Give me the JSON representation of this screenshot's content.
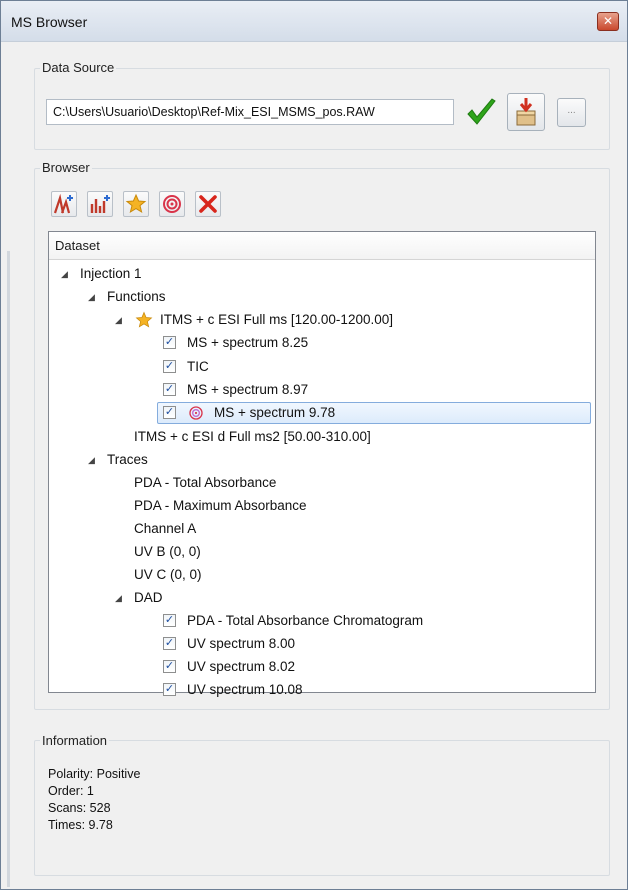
{
  "window": {
    "title": "MS Browser",
    "close_glyph": "✕"
  },
  "data_source": {
    "label": "Data Source",
    "path_value": "C:\\Users\\Usuario\\Desktop\\Ref-Mix_ESI_MSMS_pos.RAW",
    "browse_label": "..."
  },
  "browser": {
    "label": "Browser",
    "toolbar_icons": [
      "add-spectrum-icon",
      "add-chromatogram-icon",
      "star-icon",
      "target-icon",
      "delete-icon"
    ],
    "header": "Dataset",
    "tree": {
      "injection": "Injection 1",
      "functions": "Functions",
      "func1": "ITMS + c ESI Full ms [120.00-1200.00]",
      "func1_children": [
        "MS + spectrum 8.25",
        "TIC",
        "MS + spectrum 8.97",
        "MS + spectrum 9.78"
      ],
      "func2": "ITMS + c ESI d Full ms2  [50.00-310.00]",
      "traces": "Traces",
      "trace_items": [
        "PDA - Total Absorbance",
        "PDA - Maximum Absorbance",
        "Channel A",
        "UV B (0, 0)",
        "UV C (0, 0)"
      ],
      "dad": "DAD",
      "dad_children": [
        "PDA - Total Absorbance Chromatogram",
        "UV spectrum 8.00",
        "UV spectrum 8.02",
        "UV spectrum 10.08"
      ]
    }
  },
  "information": {
    "label": "Information",
    "polarity": "Polarity: Positive",
    "order": "Order: 1",
    "scans": "Scans:  528",
    "times": "Times:  9.78"
  },
  "colors": {
    "accent_check": "#2ea41a",
    "selection": "#dcebfc",
    "close": "#c9482d"
  }
}
